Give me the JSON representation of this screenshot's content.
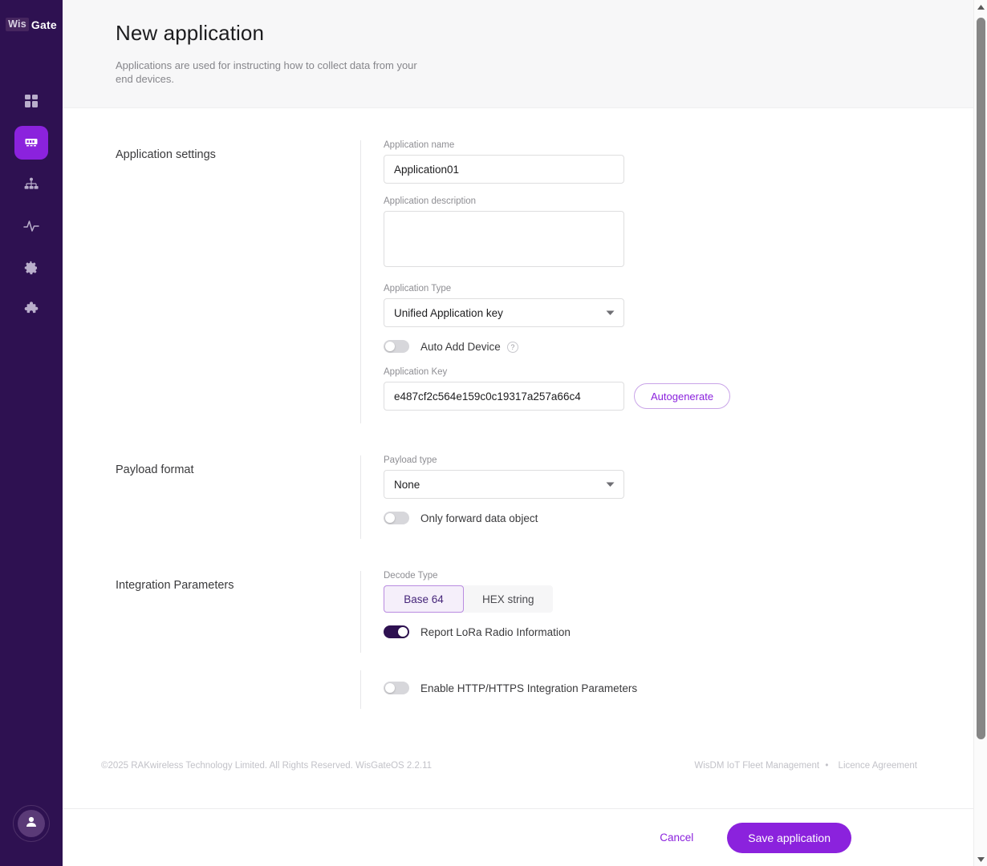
{
  "sidebar": {
    "logo": {
      "prefix": "Wis",
      "suffix": "Gate"
    },
    "items": [
      {
        "name": "dashboard",
        "icon": "grid-icon",
        "active": false
      },
      {
        "name": "applications",
        "icon": "device-card-icon",
        "active": true
      },
      {
        "name": "network",
        "icon": "network-node-icon",
        "active": false
      },
      {
        "name": "monitoring",
        "icon": "activity-pulse-icon",
        "active": false
      },
      {
        "name": "settings",
        "icon": "gear-icon",
        "active": false
      },
      {
        "name": "plugins",
        "icon": "puzzle-icon",
        "active": false
      }
    ],
    "account_icon": "user-avatar-icon"
  },
  "header": {
    "title": "New application",
    "subtitle": "Applications are used for instructing how to collect data from your end devices."
  },
  "sections": {
    "application_settings": {
      "label": "Application settings",
      "name_label": "Application name",
      "name_value": "Application01",
      "description_label": "Application description",
      "description_value": "",
      "description_placeholder": "",
      "type_label": "Application Type",
      "type_value": "Unified Application key",
      "auto_add_device_label": "Auto Add Device",
      "auto_add_device_on": false,
      "help_glyph": "?",
      "key_label": "Application Key",
      "key_value": "e487cf2c564e159c0c19317a257a66c4",
      "autogenerate_label": "Autogenerate"
    },
    "payload_format": {
      "label": "Payload format",
      "type_label": "Payload type",
      "type_value": "None",
      "only_forward_label": "Only forward data object",
      "only_forward_on": false
    },
    "integration_parameters": {
      "label": "Integration Parameters",
      "decode_type_label": "Decode Type",
      "decode_options": [
        "Base 64",
        "HEX string"
      ],
      "decode_selected": "Base 64",
      "report_lora_label": "Report LoRa Radio Information",
      "report_lora_on": true,
      "enable_http_label": "Enable HTTP/HTTPS Integration Parameters",
      "enable_http_on": false
    }
  },
  "footer": {
    "copyright": "©2025 RAKwireless Technology Limited. All Rights Reserved. WisGateOS 2.2.11",
    "fleet_link": "WisDM IoT Fleet Management",
    "separator": "•",
    "licence_link": "Licence Agreement"
  },
  "actions": {
    "cancel_label": "Cancel",
    "save_label": "Save application"
  },
  "colors": {
    "sidebar_bg": "#2e1151",
    "accent": "#8b22dd",
    "toggle_on": "#2e1151",
    "segment_selected_bg": "#f5effa"
  }
}
